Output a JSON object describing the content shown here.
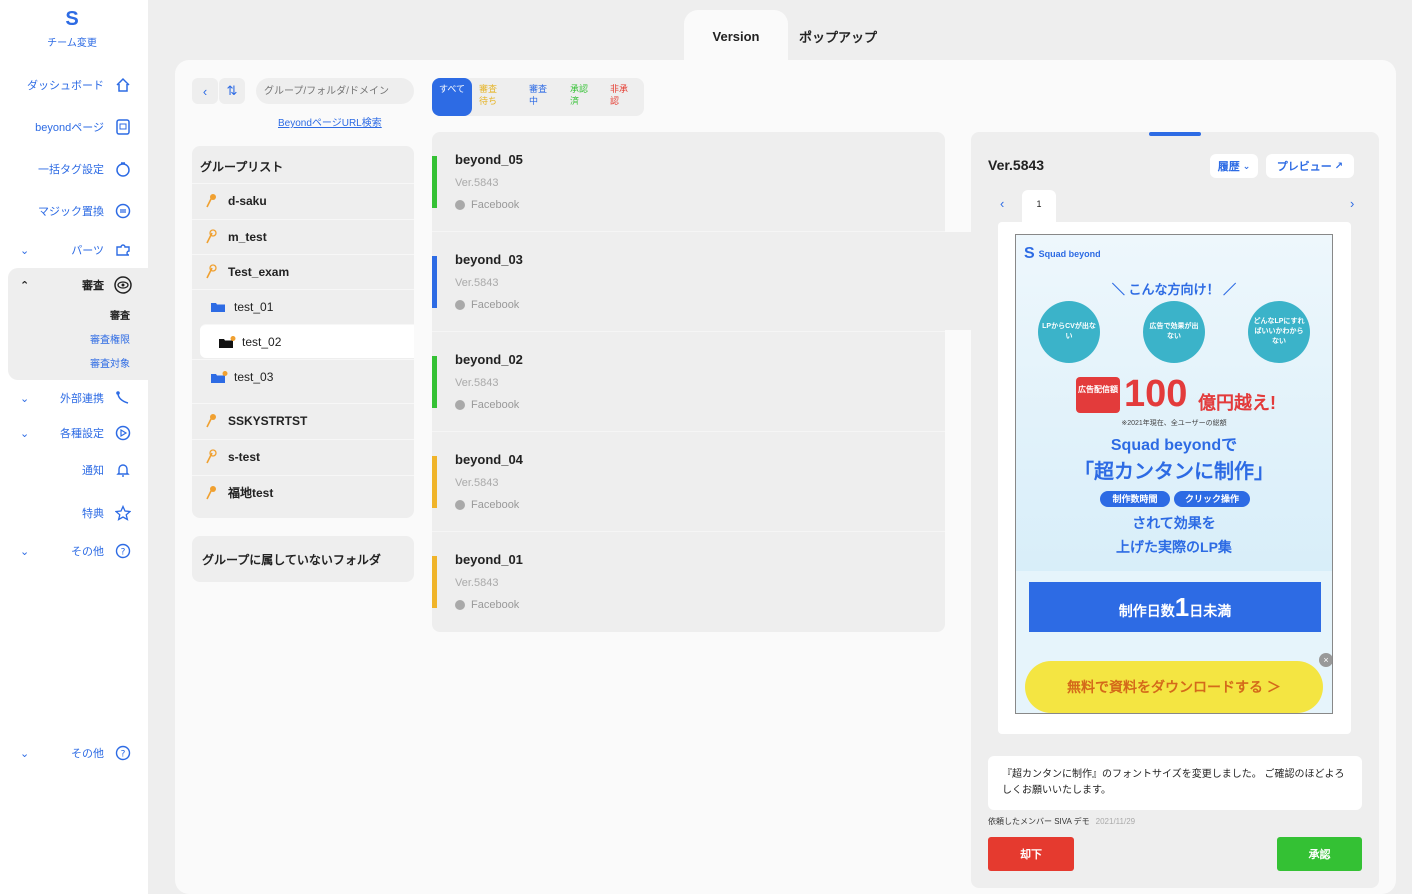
{
  "sidebar": {
    "team_label": "チーム変更",
    "items": [
      {
        "label": "ダッシュボード",
        "icon": "home-icon"
      },
      {
        "label": "beyondページ",
        "icon": "page-icon"
      },
      {
        "label": "一括タグ設定",
        "icon": "tag-icon"
      },
      {
        "label": "マジック置換",
        "icon": "replace-icon"
      },
      {
        "label": "パーツ",
        "icon": "puzzle-icon"
      },
      {
        "label": "審査",
        "icon": "eye-icon"
      },
      {
        "label": "外部連携",
        "icon": "link-icon"
      },
      {
        "label": "各種設定",
        "icon": "settings-icon"
      },
      {
        "label": "通知",
        "icon": "bell-icon"
      },
      {
        "label": "特典",
        "icon": "star-icon"
      },
      {
        "label": "その他",
        "icon": "help-icon"
      },
      {
        "label": "その他",
        "icon": "help-icon"
      }
    ],
    "review_sub": [
      "審査",
      "審査権限",
      "審査対象"
    ]
  },
  "tabs": {
    "version": "Version",
    "popup": "ポップアップ"
  },
  "search": {
    "placeholder": "グループ/フォルダ/ドメイン",
    "url_link": "BeyondページURL検索"
  },
  "groups": {
    "title": "グループリスト",
    "items": [
      "d-saku",
      "m_test",
      "Test_exam",
      "test_01",
      "test_02",
      "test_03",
      "SSKYSTRTST",
      "s-test",
      "福地test"
    ],
    "ungrouped": "グループに属していないフォルダ"
  },
  "filters": [
    "すべて",
    "審査待ち",
    "審査中",
    "承認済",
    "非承認"
  ],
  "versions": [
    {
      "name": "beyond_05",
      "ver": "Ver.5843",
      "platform": "Facebook",
      "color": "#34c134"
    },
    {
      "name": "beyond_03",
      "ver": "Ver.5843",
      "platform": "Facebook",
      "color": "#2d6be4"
    },
    {
      "name": "beyond_02",
      "ver": "Ver.5843",
      "platform": "Facebook",
      "color": "#34c134"
    },
    {
      "name": "beyond_04",
      "ver": "Ver.5843",
      "platform": "Facebook",
      "color": "#f0b429"
    },
    {
      "name": "beyond_01",
      "ver": "Ver.5843",
      "platform": "Facebook",
      "color": "#f0b429"
    }
  ],
  "detail": {
    "title": "Ver.5843",
    "history_label": "履歴",
    "preview_label": "プレビュー",
    "page_tab": "1",
    "comment": "『超カンタンに制作』のフォントサイズを変更しました。 ご確認のほどよろしくお願いいたします。",
    "requester": "依頼したメンバー SIVA デモ",
    "date": "2021/11/29",
    "reject_label": "却下",
    "approve_label": "承認"
  },
  "lp": {
    "logo": "Squad beyond",
    "heading": "＼ こんな方向け！ ／",
    "bubbles": [
      "LPからCVが出ない",
      "広告で効果が出ない",
      "どんなLPにすればいいかわからない"
    ],
    "badge": "広告配信額",
    "big_number": "100",
    "big_suffix": "億円越え!",
    "note": "※2021年現在、全ユーザーの総額",
    "squad_line": "Squad beyondで",
    "kantan_line": "「超カンタンに制作」",
    "pill1": "制作数時間",
    "pill2": "クリック操作",
    "line_a": "されて効果を",
    "line_b": "上げた実際のLP集",
    "block_pre": "制作日数",
    "block_big": "1",
    "block_post": "日未満",
    "cta": "無料で資料をダウンロードする ＞"
  },
  "colors": {
    "accent": "#2d6be4",
    "reject": "#e53a2f",
    "approve": "#34c134"
  }
}
